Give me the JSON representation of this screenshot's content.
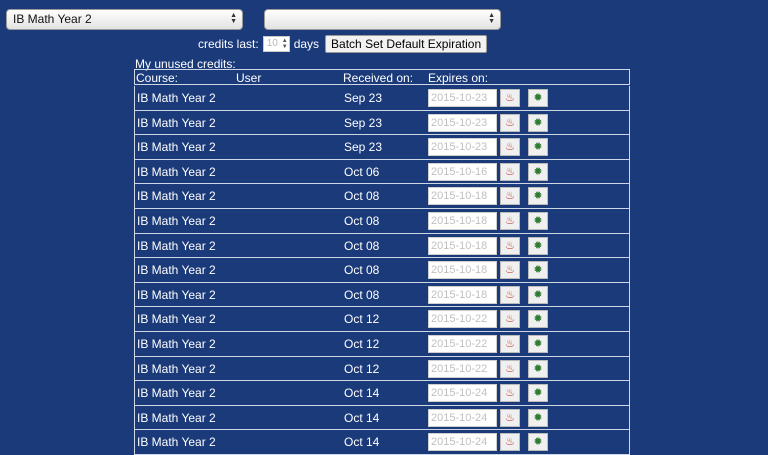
{
  "selects": {
    "course": "IB Math Year 2",
    "user": ""
  },
  "credits_bar": {
    "label": "credits last:",
    "days_value": "10",
    "days_label": "days",
    "batch_button": "Batch Set Default Expiration"
  },
  "table": {
    "section_label": "My unused credits:",
    "headers": {
      "course": "Course:",
      "user": "User",
      "received": "Received on:",
      "expires": "Expires on:"
    },
    "rows": [
      {
        "course": "IB Math Year 2",
        "received": "Sep 23",
        "expires": "2015-10-23"
      },
      {
        "course": "IB Math Year 2",
        "received": "Sep 23",
        "expires": "2015-10-23"
      },
      {
        "course": "IB Math Year 2",
        "received": "Sep 23",
        "expires": "2015-10-23"
      },
      {
        "course": "IB Math Year 2",
        "received": "Oct 06",
        "expires": "2015-10-16"
      },
      {
        "course": "IB Math Year 2",
        "received": "Oct 08",
        "expires": "2015-10-18"
      },
      {
        "course": "IB Math Year 2",
        "received": "Oct 08",
        "expires": "2015-10-18"
      },
      {
        "course": "IB Math Year 2",
        "received": "Oct 08",
        "expires": "2015-10-18"
      },
      {
        "course": "IB Math Year 2",
        "received": "Oct 08",
        "expires": "2015-10-18"
      },
      {
        "course": "IB Math Year 2",
        "received": "Oct 08",
        "expires": "2015-10-18"
      },
      {
        "course": "IB Math Year 2",
        "received": "Oct 12",
        "expires": "2015-10-22"
      },
      {
        "course": "IB Math Year 2",
        "received": "Oct 12",
        "expires": "2015-10-22"
      },
      {
        "course": "IB Math Year 2",
        "received": "Oct 12",
        "expires": "2015-10-22"
      },
      {
        "course": "IB Math Year 2",
        "received": "Oct 14",
        "expires": "2015-10-24"
      },
      {
        "course": "IB Math Year 2",
        "received": "Oct 14",
        "expires": "2015-10-24"
      },
      {
        "course": "IB Math Year 2",
        "received": "Oct 14",
        "expires": "2015-10-24"
      }
    ]
  },
  "icons": {
    "burn": "flame-icon",
    "confirm": "starburst-icon"
  },
  "colors": {
    "background": "#1a3a7a",
    "burn_icon": "#c0392b",
    "confirm_icon": "#2e7d32"
  }
}
